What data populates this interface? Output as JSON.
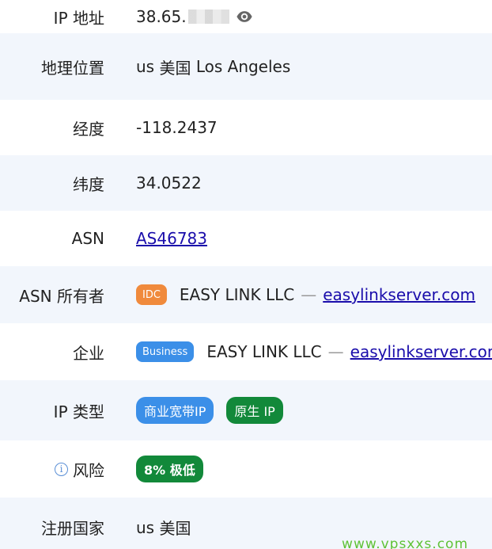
{
  "rows": [
    {
      "label": "IP 地址",
      "value_prefix": "38.65."
    },
    {
      "label": "地理位置",
      "country_code": "us",
      "country": "美国",
      "city": "Los Angeles"
    },
    {
      "label": "经度",
      "value": "-118.2437"
    },
    {
      "label": "纬度",
      "value": "34.0522"
    },
    {
      "label": "ASN",
      "value": "AS46783"
    },
    {
      "label": "ASN 所有者",
      "badge": "IDC",
      "name": "EASY LINK LLC",
      "dash": "—",
      "domain": "easylinkserver.com"
    },
    {
      "label": "企业",
      "badge": "Business",
      "name": "EASY LINK LLC",
      "dash": "—",
      "domain": "easylinkserver.com"
    },
    {
      "label": "IP 类型",
      "badges": [
        "商业宽带IP",
        "原生 IP"
      ]
    },
    {
      "label": "风险",
      "info_glyph": "i",
      "badge": "8% 极低"
    },
    {
      "label": "注册国家",
      "country_code": "us",
      "country": "美国"
    }
  ],
  "watermark": "www.vpsxxs.com",
  "icons": {
    "reveal": "eye-icon",
    "risk_info": "info-icon"
  },
  "colors": {
    "row_alt_bg": "#f2f6fc",
    "idc_badge": "#f08a3c",
    "business_badge": "#3b8fe8",
    "native_badge": "#12893a",
    "risk_badge": "#12893a",
    "link": "#1a0dab",
    "watermark": "#5fc236"
  }
}
